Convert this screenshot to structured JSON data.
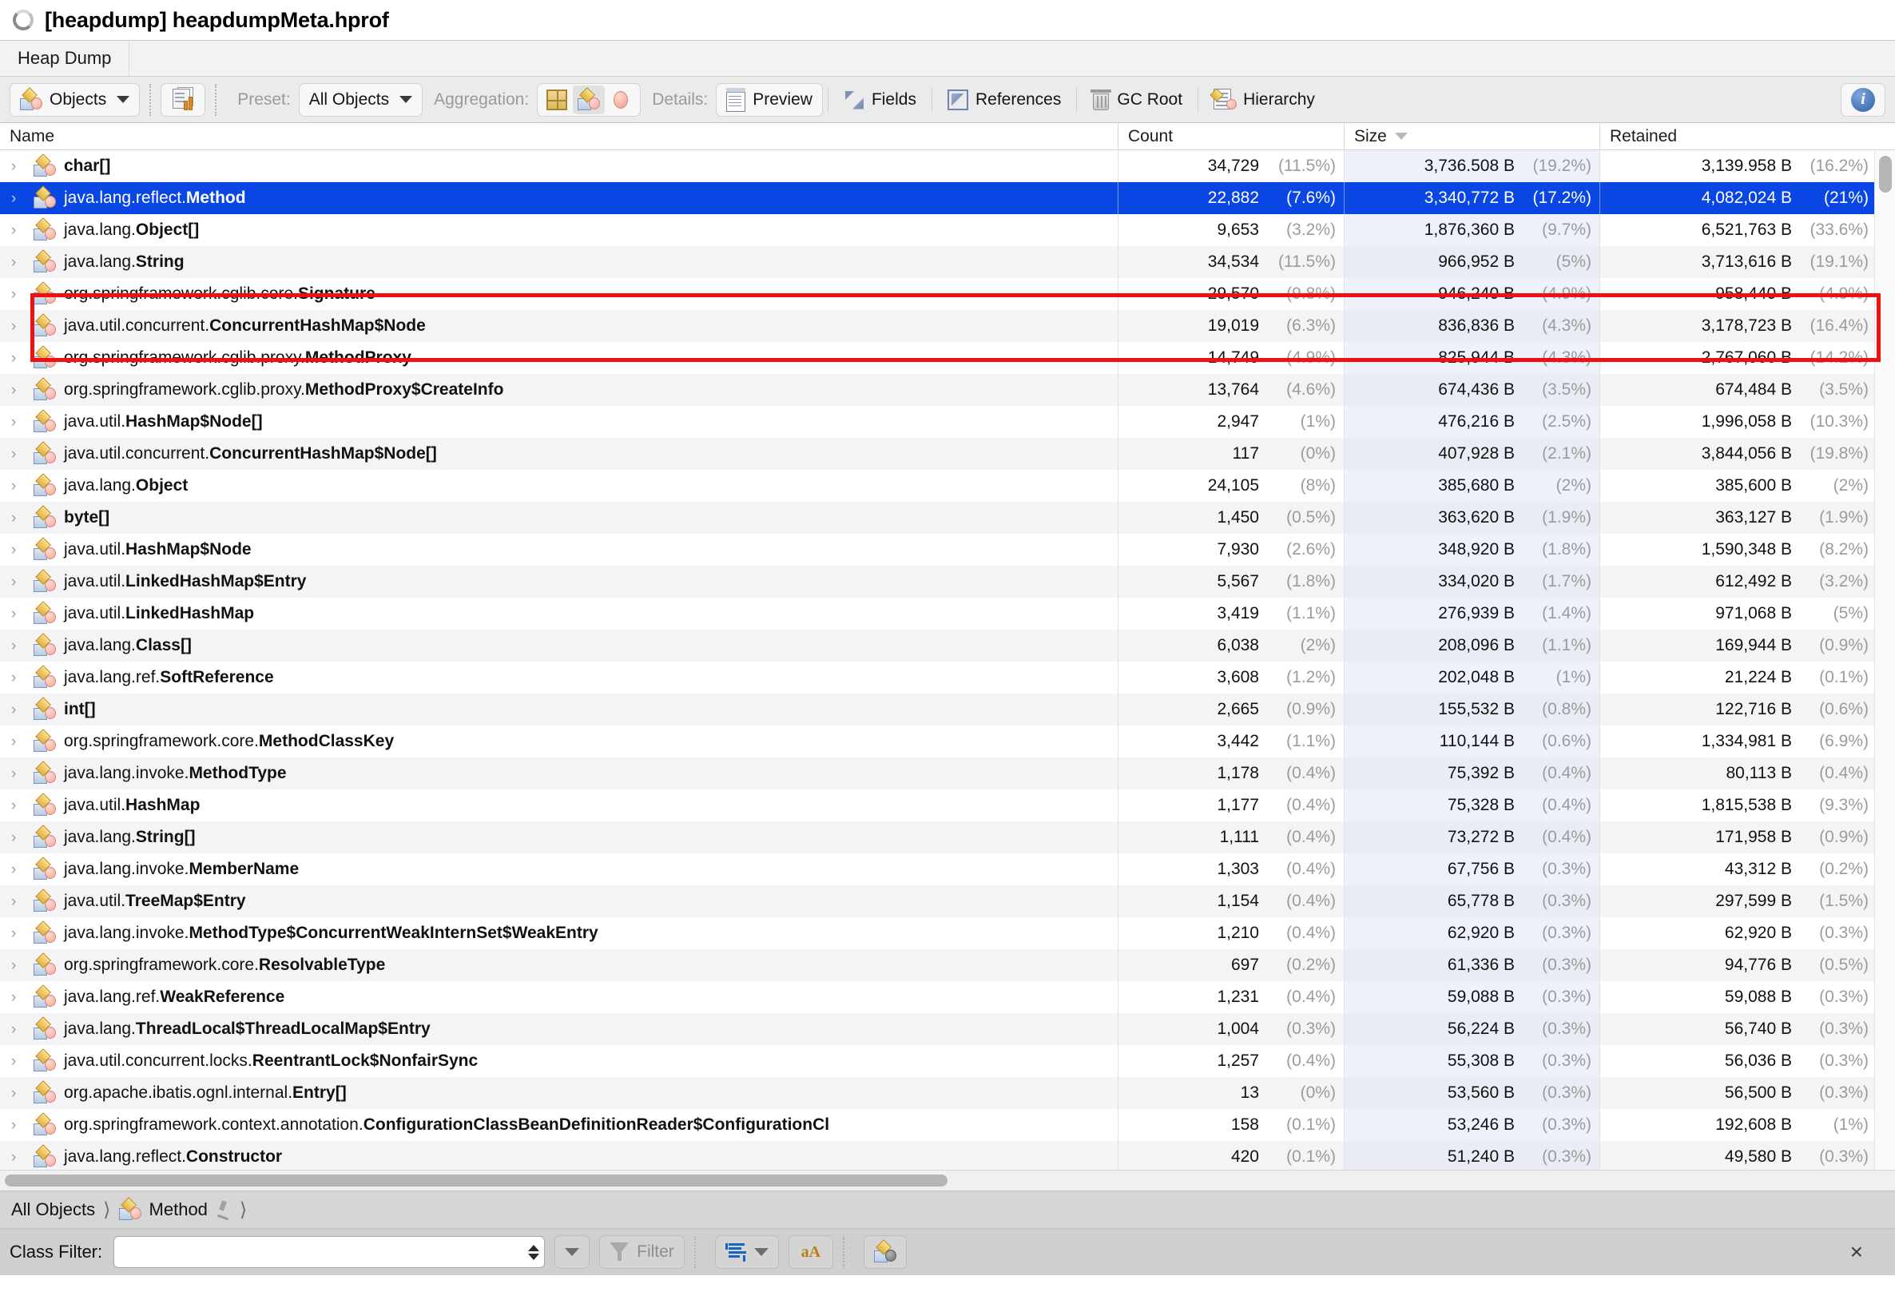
{
  "window": {
    "title": "[heapdump] heapdumpMeta.hprof",
    "spinner_icon": "loading-spinner-icon"
  },
  "tabs": [
    {
      "label": "Heap Dump"
    }
  ],
  "toolbar": {
    "objects_button": {
      "label": "Objects",
      "icon": "objects-icon"
    },
    "report_button": {
      "icon": "report-icon"
    },
    "preset_label": "Preset:",
    "preset_value": "All Objects",
    "aggregation_label": "Aggregation:",
    "aggregation_options": [
      {
        "icon": "grid-icon",
        "name": "classes"
      },
      {
        "icon": "objects-icon",
        "name": "objects",
        "active": true
      },
      {
        "icon": "instance-icon",
        "name": "instances"
      }
    ],
    "details_label": "Details:",
    "details_buttons": [
      {
        "label": "Preview",
        "icon": "document-icon"
      },
      {
        "label": "Fields",
        "icon": "fields-arrow-icon"
      },
      {
        "label": "References",
        "icon": "references-arrow-icon"
      },
      {
        "label": "GC Root",
        "icon": "trash-icon"
      },
      {
        "label": "Hierarchy",
        "icon": "hierarchy-icon"
      }
    ],
    "info_button": {
      "icon": "info-icon",
      "label": "i"
    }
  },
  "table": {
    "columns": [
      {
        "key": "name",
        "label": "Name",
        "sorted": false
      },
      {
        "key": "count",
        "label": "Count",
        "sorted": false
      },
      {
        "key": "size",
        "label": "Size",
        "sorted": true
      },
      {
        "key": "retained",
        "label": "Retained",
        "sorted": false
      }
    ],
    "rows": [
      {
        "pkg": "",
        "simple": "char[]",
        "count": "34,729",
        "count_pct": "(11.5%)",
        "size": "3,736.508 B",
        "size_pct": "(19.2%)",
        "retained": "3,139.958 B",
        "retained_pct": "(16.2%)",
        "selected": false
      },
      {
        "pkg": "java.lang.reflect.",
        "simple": "Method",
        "count": "22,882",
        "count_pct": "(7.6%)",
        "size": "3,340,772 B",
        "size_pct": "(17.2%)",
        "retained": "4,082,024 B",
        "retained_pct": "(21%)",
        "selected": true
      },
      {
        "pkg": "java.lang.",
        "simple": "Object[]",
        "count": "9,653",
        "count_pct": "(3.2%)",
        "size": "1,876,360 B",
        "size_pct": "(9.7%)",
        "retained": "6,521,763 B",
        "retained_pct": "(33.6%)",
        "selected": false
      },
      {
        "pkg": "java.lang.",
        "simple": "String",
        "count": "34,534",
        "count_pct": "(11.5%)",
        "size": "966,952 B",
        "size_pct": "(5%)",
        "retained": "3,713,616 B",
        "retained_pct": "(19.1%)",
        "selected": false
      },
      {
        "pkg": "org.springframework.cglib.core.",
        "simple": "Signature",
        "count": "29,570",
        "count_pct": "(9.8%)",
        "size": "946,240 B",
        "size_pct": "(4.9%)",
        "retained": "958,440 B",
        "retained_pct": "(4.9%)",
        "selected": false
      },
      {
        "pkg": "java.util.concurrent.",
        "simple": "ConcurrentHashMap$Node",
        "count": "19,019",
        "count_pct": "(6.3%)",
        "size": "836,836 B",
        "size_pct": "(4.3%)",
        "retained": "3,178,723 B",
        "retained_pct": "(16.4%)",
        "selected": false
      },
      {
        "pkg": "org.springframework.cglib.proxy.",
        "simple": "MethodProxy",
        "count": "14,749",
        "count_pct": "(4.9%)",
        "size": "825,944 B",
        "size_pct": "(4.3%)",
        "retained": "2,767,060 B",
        "retained_pct": "(14.2%)",
        "selected": false
      },
      {
        "pkg": "org.springframework.cglib.proxy.",
        "simple": "MethodProxy$CreateInfo",
        "count": "13,764",
        "count_pct": "(4.6%)",
        "size": "674,436 B",
        "size_pct": "(3.5%)",
        "retained": "674,484 B",
        "retained_pct": "(3.5%)",
        "selected": false
      },
      {
        "pkg": "java.util.",
        "simple": "HashMap$Node[]",
        "count": "2,947",
        "count_pct": "(1%)",
        "size": "476,216 B",
        "size_pct": "(2.5%)",
        "retained": "1,996,058 B",
        "retained_pct": "(10.3%)",
        "selected": false
      },
      {
        "pkg": "java.util.concurrent.",
        "simple": "ConcurrentHashMap$Node[]",
        "count": "117",
        "count_pct": "(0%)",
        "size": "407,928 B",
        "size_pct": "(2.1%)",
        "retained": "3,844,056 B",
        "retained_pct": "(19.8%)",
        "selected": false
      },
      {
        "pkg": "java.lang.",
        "simple": "Object",
        "count": "24,105",
        "count_pct": "(8%)",
        "size": "385,680 B",
        "size_pct": "(2%)",
        "retained": "385,600 B",
        "retained_pct": "(2%)",
        "selected": false
      },
      {
        "pkg": "",
        "simple": "byte[]",
        "count": "1,450",
        "count_pct": "(0.5%)",
        "size": "363,620 B",
        "size_pct": "(1.9%)",
        "retained": "363,127 B",
        "retained_pct": "(1.9%)",
        "selected": false
      },
      {
        "pkg": "java.util.",
        "simple": "HashMap$Node",
        "count": "7,930",
        "count_pct": "(2.6%)",
        "size": "348,920 B",
        "size_pct": "(1.8%)",
        "retained": "1,590,348 B",
        "retained_pct": "(8.2%)",
        "selected": false
      },
      {
        "pkg": "java.util.",
        "simple": "LinkedHashMap$Entry",
        "count": "5,567",
        "count_pct": "(1.8%)",
        "size": "334,020 B",
        "size_pct": "(1.7%)",
        "retained": "612,492 B",
        "retained_pct": "(3.2%)",
        "selected": false
      },
      {
        "pkg": "java.util.",
        "simple": "LinkedHashMap",
        "count": "3,419",
        "count_pct": "(1.1%)",
        "size": "276,939 B",
        "size_pct": "(1.4%)",
        "retained": "971,068 B",
        "retained_pct": "(5%)",
        "selected": false
      },
      {
        "pkg": "java.lang.",
        "simple": "Class[]",
        "count": "6,038",
        "count_pct": "(2%)",
        "size": "208,096 B",
        "size_pct": "(1.1%)",
        "retained": "169,944 B",
        "retained_pct": "(0.9%)",
        "selected": false
      },
      {
        "pkg": "java.lang.ref.",
        "simple": "SoftReference",
        "count": "3,608",
        "count_pct": "(1.2%)",
        "size": "202,048 B",
        "size_pct": "(1%)",
        "retained": "21,224 B",
        "retained_pct": "(0.1%)",
        "selected": false
      },
      {
        "pkg": "",
        "simple": "int[]",
        "count": "2,665",
        "count_pct": "(0.9%)",
        "size": "155,532 B",
        "size_pct": "(0.8%)",
        "retained": "122,716 B",
        "retained_pct": "(0.6%)",
        "selected": false
      },
      {
        "pkg": "org.springframework.core.",
        "simple": "MethodClassKey",
        "count": "3,442",
        "count_pct": "(1.1%)",
        "size": "110,144 B",
        "size_pct": "(0.6%)",
        "retained": "1,334,981 B",
        "retained_pct": "(6.9%)",
        "selected": false
      },
      {
        "pkg": "java.lang.invoke.",
        "simple": "MethodType",
        "count": "1,178",
        "count_pct": "(0.4%)",
        "size": "75,392 B",
        "size_pct": "(0.4%)",
        "retained": "80,113 B",
        "retained_pct": "(0.4%)",
        "selected": false
      },
      {
        "pkg": "java.util.",
        "simple": "HashMap",
        "count": "1,177",
        "count_pct": "(0.4%)",
        "size": "75,328 B",
        "size_pct": "(0.4%)",
        "retained": "1,815,538 B",
        "retained_pct": "(9.3%)",
        "selected": false
      },
      {
        "pkg": "java.lang.",
        "simple": "String[]",
        "count": "1,111",
        "count_pct": "(0.4%)",
        "size": "73,272 B",
        "size_pct": "(0.4%)",
        "retained": "171,958 B",
        "retained_pct": "(0.9%)",
        "selected": false
      },
      {
        "pkg": "java.lang.invoke.",
        "simple": "MemberName",
        "count": "1,303",
        "count_pct": "(0.4%)",
        "size": "67,756 B",
        "size_pct": "(0.3%)",
        "retained": "43,312 B",
        "retained_pct": "(0.2%)",
        "selected": false
      },
      {
        "pkg": "java.util.",
        "simple": "TreeMap$Entry",
        "count": "1,154",
        "count_pct": "(0.4%)",
        "size": "65,778 B",
        "size_pct": "(0.3%)",
        "retained": "297,599 B",
        "retained_pct": "(1.5%)",
        "selected": false
      },
      {
        "pkg": "java.lang.invoke.",
        "simple": "MethodType$ConcurrentWeakInternSet$WeakEntry",
        "count": "1,210",
        "count_pct": "(0.4%)",
        "size": "62,920 B",
        "size_pct": "(0.3%)",
        "retained": "62,920 B",
        "retained_pct": "(0.3%)",
        "selected": false
      },
      {
        "pkg": "org.springframework.core.",
        "simple": "ResolvableType",
        "count": "697",
        "count_pct": "(0.2%)",
        "size": "61,336 B",
        "size_pct": "(0.3%)",
        "retained": "94,776 B",
        "retained_pct": "(0.5%)",
        "selected": false
      },
      {
        "pkg": "java.lang.ref.",
        "simple": "WeakReference",
        "count": "1,231",
        "count_pct": "(0.4%)",
        "size": "59,088 B",
        "size_pct": "(0.3%)",
        "retained": "59,088 B",
        "retained_pct": "(0.3%)",
        "selected": false
      },
      {
        "pkg": "java.lang.",
        "simple": "ThreadLocal$ThreadLocalMap$Entry",
        "count": "1,004",
        "count_pct": "(0.3%)",
        "size": "56,224 B",
        "size_pct": "(0.3%)",
        "retained": "56,740 B",
        "retained_pct": "(0.3%)",
        "selected": false
      },
      {
        "pkg": "java.util.concurrent.locks.",
        "simple": "ReentrantLock$NonfairSync",
        "count": "1,257",
        "count_pct": "(0.4%)",
        "size": "55,308 B",
        "size_pct": "(0.3%)",
        "retained": "56,036 B",
        "retained_pct": "(0.3%)",
        "selected": false
      },
      {
        "pkg": "org.apache.ibatis.ognl.internal.",
        "simple": "Entry[]",
        "count": "13",
        "count_pct": "(0%)",
        "size": "53,560 B",
        "size_pct": "(0.3%)",
        "retained": "56,500 B",
        "retained_pct": "(0.3%)",
        "selected": false
      },
      {
        "pkg": "org.springframework.context.annotation.",
        "simple": "ConfigurationClassBeanDefinitionReader$ConfigurationCl",
        "count": "158",
        "count_pct": "(0.1%)",
        "size": "53,246 B",
        "size_pct": "(0.3%)",
        "retained": "192,608 B",
        "retained_pct": "(1%)",
        "selected": false
      },
      {
        "pkg": "java.lang.reflect.",
        "simple": "Constructor",
        "count": "420",
        "count_pct": "(0.1%)",
        "size": "51,240 B",
        "size_pct": "(0.3%)",
        "retained": "49,580 B",
        "retained_pct": "(0.3%)",
        "selected": false
      }
    ]
  },
  "breadcrumb": {
    "root": "All Objects",
    "current": "Method",
    "node_icon": "objects-icon",
    "pin_icon": "pin-icon"
  },
  "filter_bar": {
    "label": "Class Filter:",
    "input_value": "",
    "input_placeholder": "",
    "dropdown_icon": "chevron-down-icon",
    "filter_button": {
      "label": "Filter",
      "icon": "funnel-icon"
    },
    "view_button": {
      "icon": "bars-icon"
    },
    "case_button": {
      "icon": "match-case-icon"
    },
    "objects_button": {
      "icon": "objects-gray-icon"
    },
    "close_button": {
      "label": "×",
      "icon": "close-icon"
    }
  },
  "colors": {
    "selection": "#0a46e4",
    "annotation": "#ee1111",
    "toolbar_bg": "#ebebeb",
    "filterbar_bg": "#cfcfcf"
  }
}
